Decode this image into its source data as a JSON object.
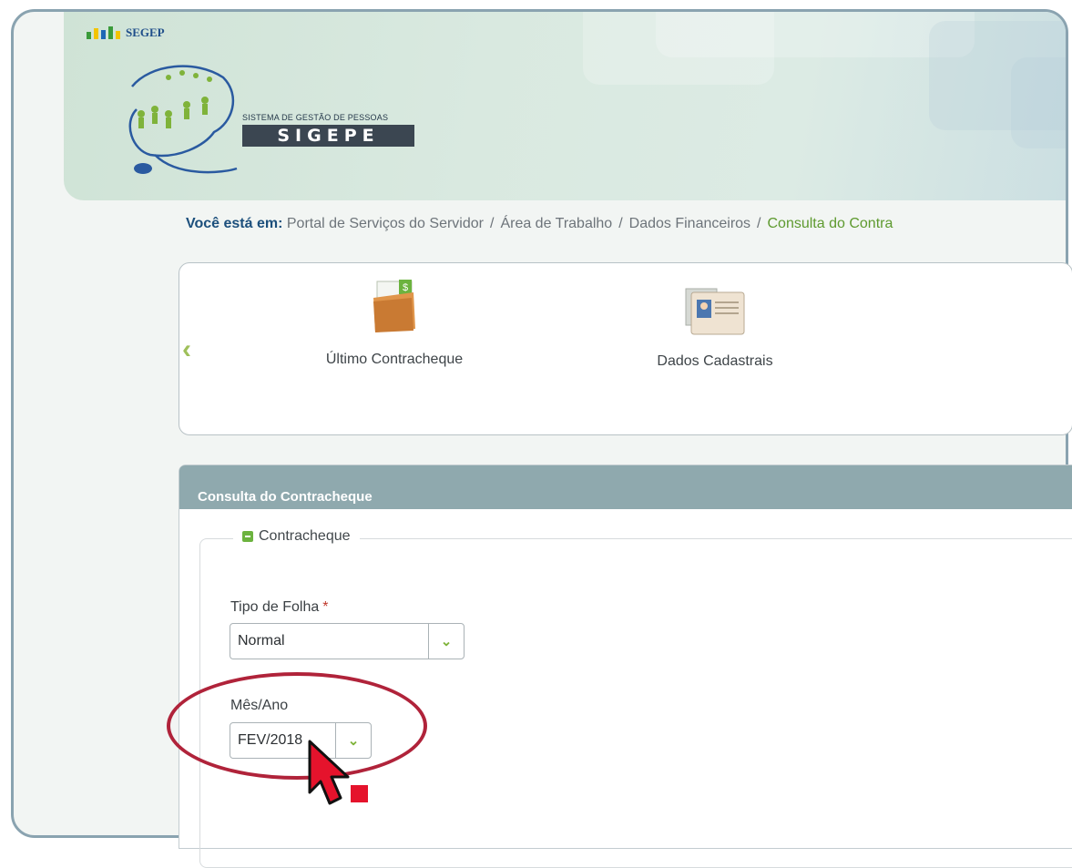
{
  "header": {
    "segep_label": "SEGEP",
    "system_subtitle": "SISTEMA DE GESTÃO DE PESSOAS",
    "system_name": "SIGEPE"
  },
  "breadcrumb": {
    "lead": "Você está em:",
    "items": [
      "Portal de Serviços do Servidor",
      "Área de Trabalho",
      "Dados Financeiros"
    ],
    "current": "Consulta do Contra"
  },
  "carousel": {
    "cards": [
      {
        "label": "Último Contracheque",
        "icon": "folder-money-icon"
      },
      {
        "label": "Dados Cadastrais",
        "icon": "id-card-icon"
      }
    ]
  },
  "panel": {
    "title": "Consulta do Contracheque",
    "fieldset_legend": "Contracheque",
    "tipo_folha": {
      "label": "Tipo de Folha",
      "required_mark": "*",
      "value": "Normal"
    },
    "mes_ano": {
      "label": "Mês/Ano",
      "value": "FEV/2018"
    }
  },
  "colors": {
    "accent_green": "#7fb33a",
    "panel_header": "#8fa9ae",
    "highlight_red": "#b0233a"
  }
}
